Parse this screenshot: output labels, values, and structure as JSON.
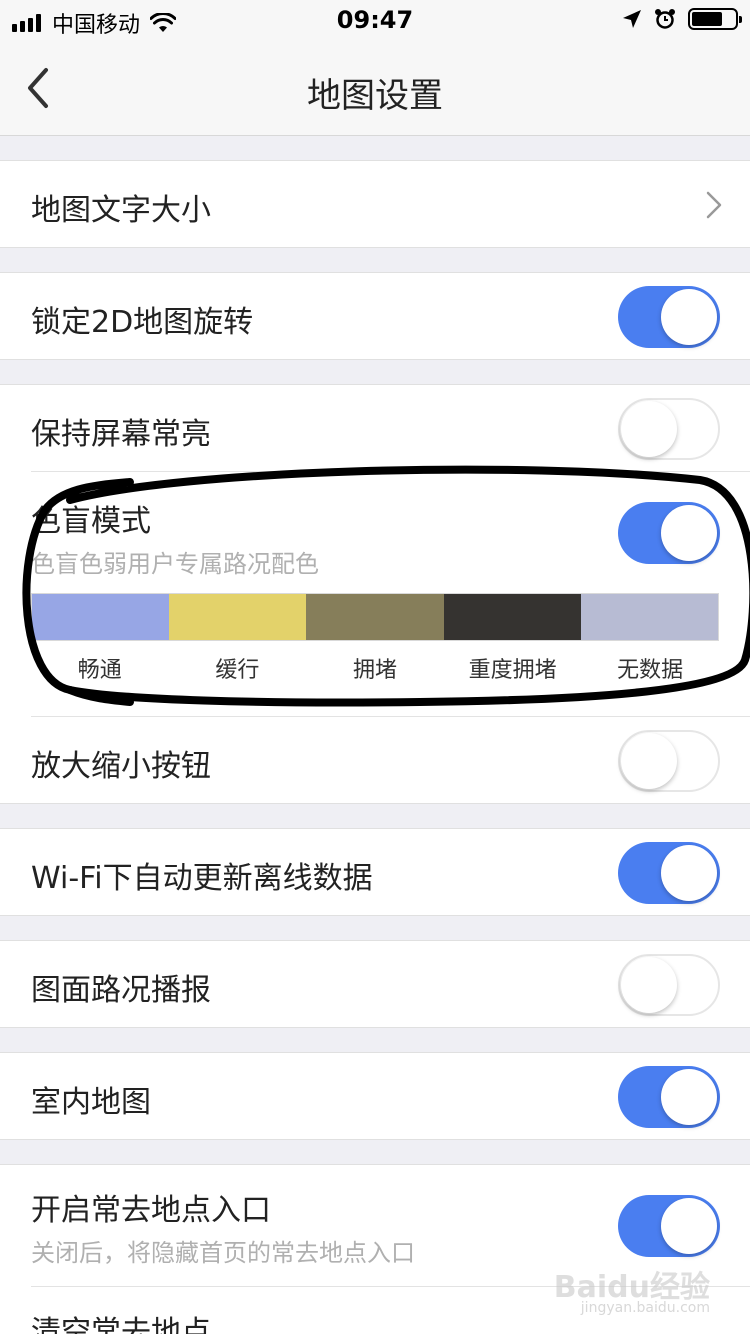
{
  "status_bar": {
    "carrier": "中国移动",
    "time": "09:47"
  },
  "nav": {
    "title": "地图设置"
  },
  "settings": {
    "map_text_size": {
      "title": "地图文字大小"
    },
    "lock_2d_rotation": {
      "title": "锁定2D地图旋转",
      "enabled": true
    },
    "keep_screen_on": {
      "title": "保持屏幕常亮",
      "enabled": false
    },
    "colorblind_mode": {
      "title": "色盲模式",
      "subtitle": "色盲色弱用户专属路况配色",
      "enabled": true,
      "legend": [
        {
          "label": "畅通",
          "color": "#97a6e5"
        },
        {
          "label": "缓行",
          "color": "#e3d26a"
        },
        {
          "label": "拥堵",
          "color": "#867e5a"
        },
        {
          "label": "重度拥堵",
          "color": "#353330"
        },
        {
          "label": "无数据",
          "color": "#b7bbd3"
        }
      ]
    },
    "zoom_buttons": {
      "title": "放大缩小按钮",
      "enabled": false
    },
    "wifi_auto_update": {
      "title": "Wi-Fi下自动更新离线数据",
      "enabled": true
    },
    "traffic_broadcast": {
      "title": "图面路况播报",
      "enabled": false
    },
    "indoor_map": {
      "title": "室内地图",
      "enabled": true
    },
    "frequent_places": {
      "title": "开启常去地点入口",
      "subtitle": "关闭后，将隐藏首页的常去地点入口",
      "enabled": true
    },
    "clear_frequent_places": {
      "title": "清空常去地点"
    }
  },
  "watermark": {
    "text": "Baidu经验",
    "sub": "jingyan.baidu.com"
  },
  "colors": {
    "toggle_on": "#4a7ef0",
    "background": "#efeff4"
  }
}
